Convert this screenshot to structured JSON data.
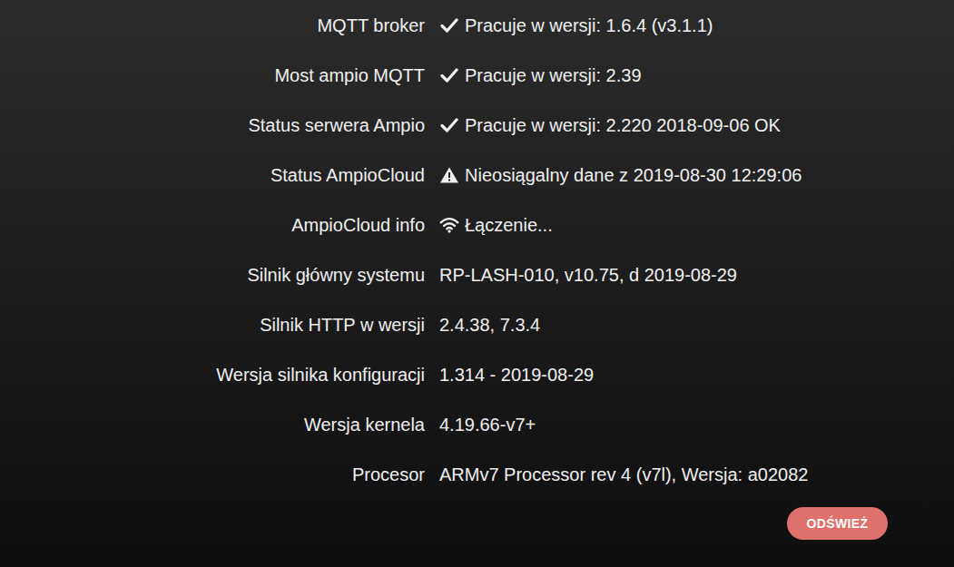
{
  "rows": [
    {
      "label": "MQTT broker",
      "kind": "ok",
      "value": "Pracuje w wersji: 1.6.4 (v3.1.1)"
    },
    {
      "label": "Most ampio MQTT",
      "kind": "ok",
      "value": "Pracuje w wersji: 2.39"
    },
    {
      "label": "Status serwera Ampio",
      "kind": "ok",
      "value": "Pracuje w wersji: 2.220 2018-09-06 OK"
    },
    {
      "label": "Status AmpioCloud",
      "kind": "warning",
      "value": "Nieosiągalny dane z 2019-08-30 12:29:06"
    },
    {
      "label": "AmpioCloud info",
      "kind": "wifi",
      "value": "Łączenie..."
    },
    {
      "label": "Silnik główny systemu",
      "kind": "none",
      "value": "RP-LASH-010, v10.75, d 2019-08-29"
    },
    {
      "label": "Silnik HTTP w wersji",
      "kind": "none",
      "value": "2.4.38, 7.3.4"
    },
    {
      "label": "Wersja silnika konfiguracji",
      "kind": "none",
      "value": "1.314 - 2019-08-29"
    },
    {
      "label": "Wersja kernela",
      "kind": "none",
      "value": "4.19.66-v7+"
    },
    {
      "label": "Procesor",
      "kind": "none",
      "value": "ARMv7 Processor rev 4 (v7l), Wersja: a02082"
    }
  ],
  "refresh_button": "ODŚWIEŻ"
}
